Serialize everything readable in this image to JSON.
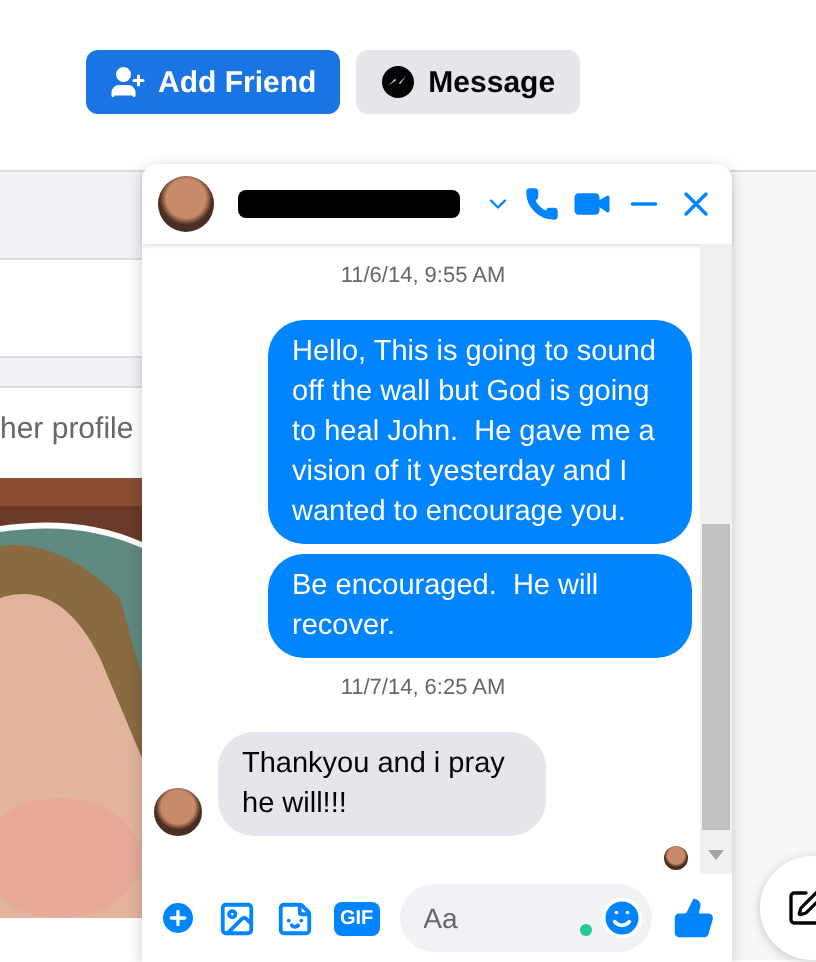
{
  "profile_actions": [
    {
      "label": "Add Friend",
      "kind": "primary"
    },
    {
      "label": "Message",
      "kind": "secondary"
    }
  ],
  "post": {
    "caption": "her profile"
  },
  "chat": {
    "messages": [
      {
        "kind": "timestamp",
        "text": "11/6/14, 9:55 AM"
      },
      {
        "kind": "outgoing",
        "text": "Hello, This is going to sound off the wall but God is going to heal John.  He gave me a vision of it yesterday and I wanted to encourage you."
      },
      {
        "kind": "outgoing",
        "text": "Be encouraged.  He will recover."
      },
      {
        "kind": "timestamp",
        "text": "11/7/14, 6:25 AM"
      },
      {
        "kind": "incoming",
        "text": "Thankyou and i pray he will!!!"
      }
    ],
    "seen": true,
    "composer": {
      "gif_label": "GIF",
      "placeholder": "Aa"
    }
  }
}
